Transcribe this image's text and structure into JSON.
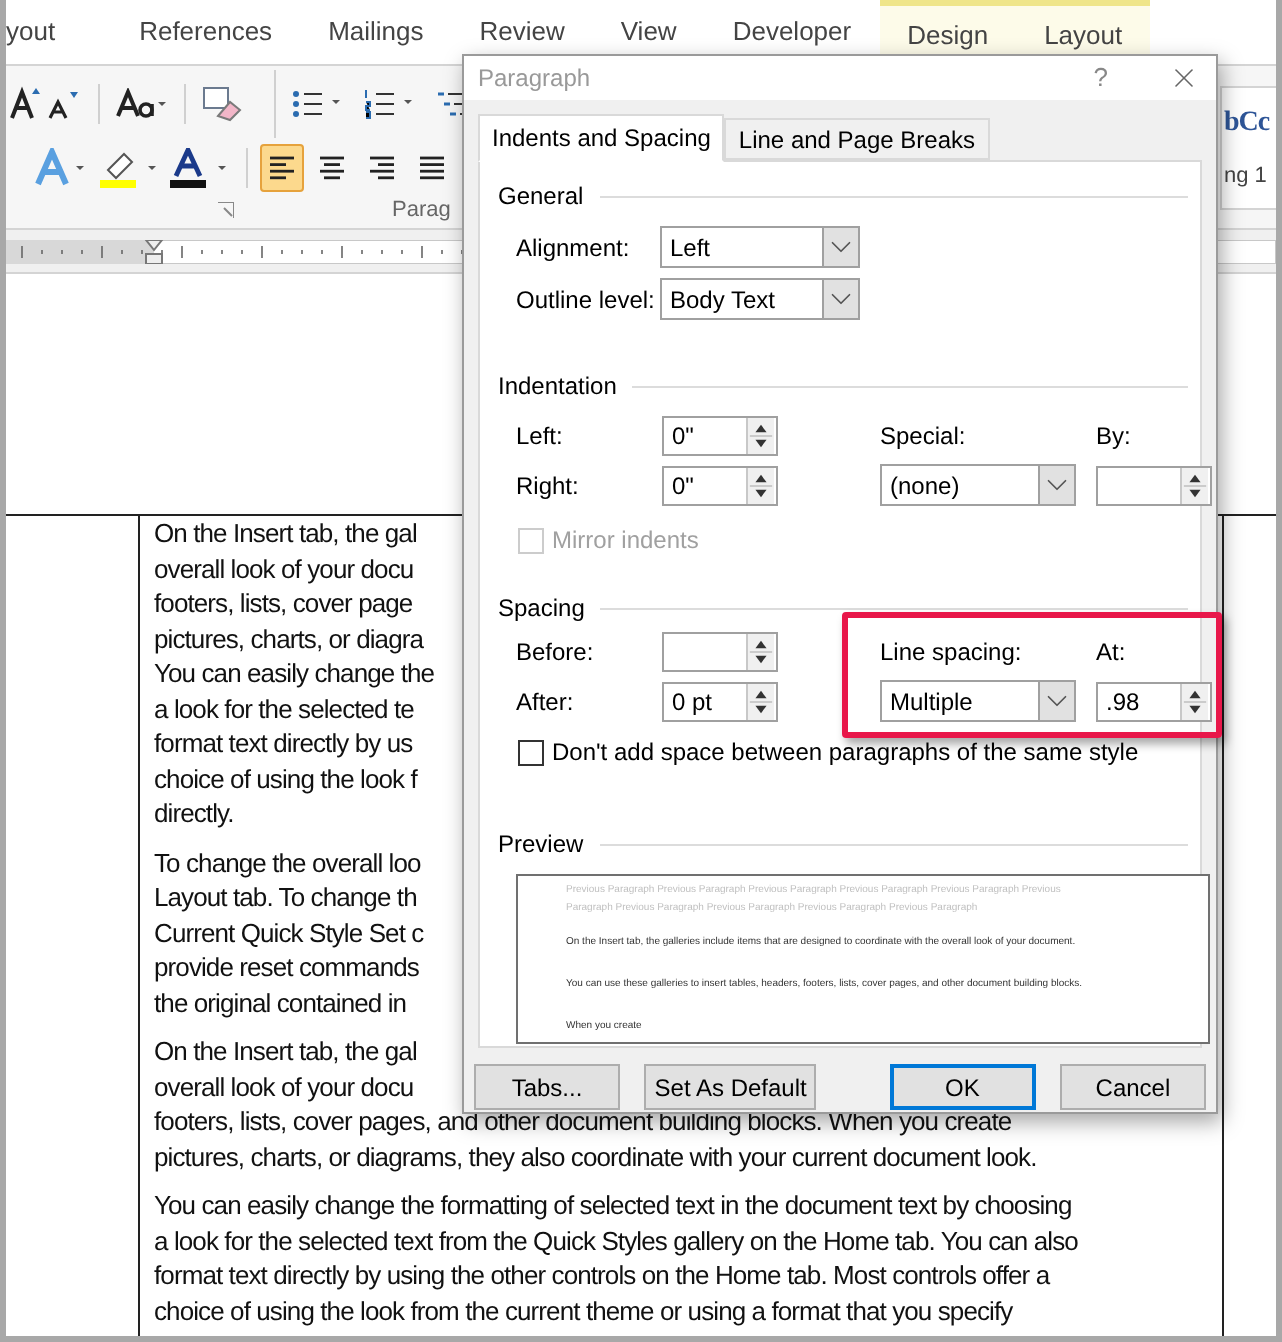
{
  "ribbon": {
    "tabs": [
      {
        "label": "yout",
        "kind": "normal"
      },
      {
        "label": "References",
        "kind": "normal"
      },
      {
        "label": "Mailings",
        "kind": "normal"
      },
      {
        "label": "Review",
        "kind": "normal"
      },
      {
        "label": "View",
        "kind": "normal"
      },
      {
        "label": "Developer",
        "kind": "normal"
      },
      {
        "label": "Design",
        "kind": "contextual"
      },
      {
        "label": "Layout",
        "kind": "contextual"
      }
    ],
    "align_buttons": [
      {
        "selected": true
      },
      {
        "selected": false
      },
      {
        "selected": false
      },
      {
        "selected": false
      }
    ],
    "group_label": "Parag",
    "styles_gallery": [
      "bCc",
      "ng 1"
    ]
  },
  "document": {
    "paragraphs": [
      {
        "lines": [
          "On the Insert tab, the gal",
          "overall look of your docu",
          "footers, lists, cover page",
          "pictures, charts, or diagra",
          "You can easily change the",
          "a look for the selected te",
          "format text directly by us",
          "choice of using the look f",
          "directly."
        ]
      },
      {
        "lines": [
          "To change the overall loo",
          "Layout tab. To change th",
          "Current Quick Style Set c",
          "provide reset commands",
          "the original contained in"
        ]
      },
      {
        "lines": [
          "On the Insert tab, the gal",
          "overall look of your docu",
          "footers, lists, cover pages, and other document building blocks. When you create",
          "pictures, charts, or diagrams, they also coordinate with your current document look."
        ]
      },
      {
        "lines": [
          "You can easily change the formatting of selected text in the document text by choosing",
          "a look for the selected text from the Quick Styles gallery on the Home tab. You can also",
          "format text directly by using the other controls on the Home tab. Most controls offer a",
          "choice of using the look from the current theme or using a format that you specify"
        ]
      }
    ]
  },
  "dialog": {
    "title": "Paragraph",
    "help": "?",
    "tabs": [
      {
        "label": "Indents and Spacing",
        "selected": true
      },
      {
        "label": "Line and Page Breaks",
        "selected": false
      }
    ],
    "general": {
      "heading": "General",
      "fields": [
        {
          "label": "Alignment:",
          "value": "Left"
        },
        {
          "label": "Outline level:",
          "value": "Body Text"
        }
      ]
    },
    "indentation": {
      "heading": "Indentation",
      "left": {
        "label": "Left:",
        "value": "0\""
      },
      "right": {
        "label": "Right:",
        "value": "0\""
      },
      "special": {
        "label": "Special:",
        "value": "(none)"
      },
      "by": {
        "label": "By:"
      },
      "mirror": {
        "label": "Mirror indents",
        "checked": false,
        "disabled": true
      }
    },
    "spacing": {
      "heading": "Spacing",
      "before": {
        "label": "Before:"
      },
      "after": {
        "label": "After:",
        "value": "0 pt"
      },
      "line_spacing": {
        "label": "Line spacing:",
        "value": "Multiple"
      },
      "at": {
        "label": "At:",
        "value": ".98"
      },
      "highlighted": true,
      "dont_add": {
        "label": "Don't add space between paragraphs of the same style",
        "checked": false,
        "disabled": false
      }
    },
    "preview": {
      "heading": "Preview",
      "previous_lines": [
        "Previous Paragraph Previous Paragraph Previous Paragraph Previous Paragraph Previous Paragraph Previous",
        "Paragraph Previous Paragraph Previous Paragraph Previous Paragraph Previous Paragraph"
      ],
      "current_lines": [
        "On the Insert tab, the galleries include items that are designed to coordinate with the overall look of your document.",
        "You can use these galleries to insert tables, headers, footers, lists, cover pages, and other document building blocks.",
        "When you create"
      ]
    },
    "buttons": [
      {
        "label": "Tabs...",
        "default": false
      },
      {
        "label": "Set As Default",
        "default": false
      },
      {
        "label": "OK",
        "default": true
      },
      {
        "label": "Cancel",
        "default": false
      }
    ]
  }
}
